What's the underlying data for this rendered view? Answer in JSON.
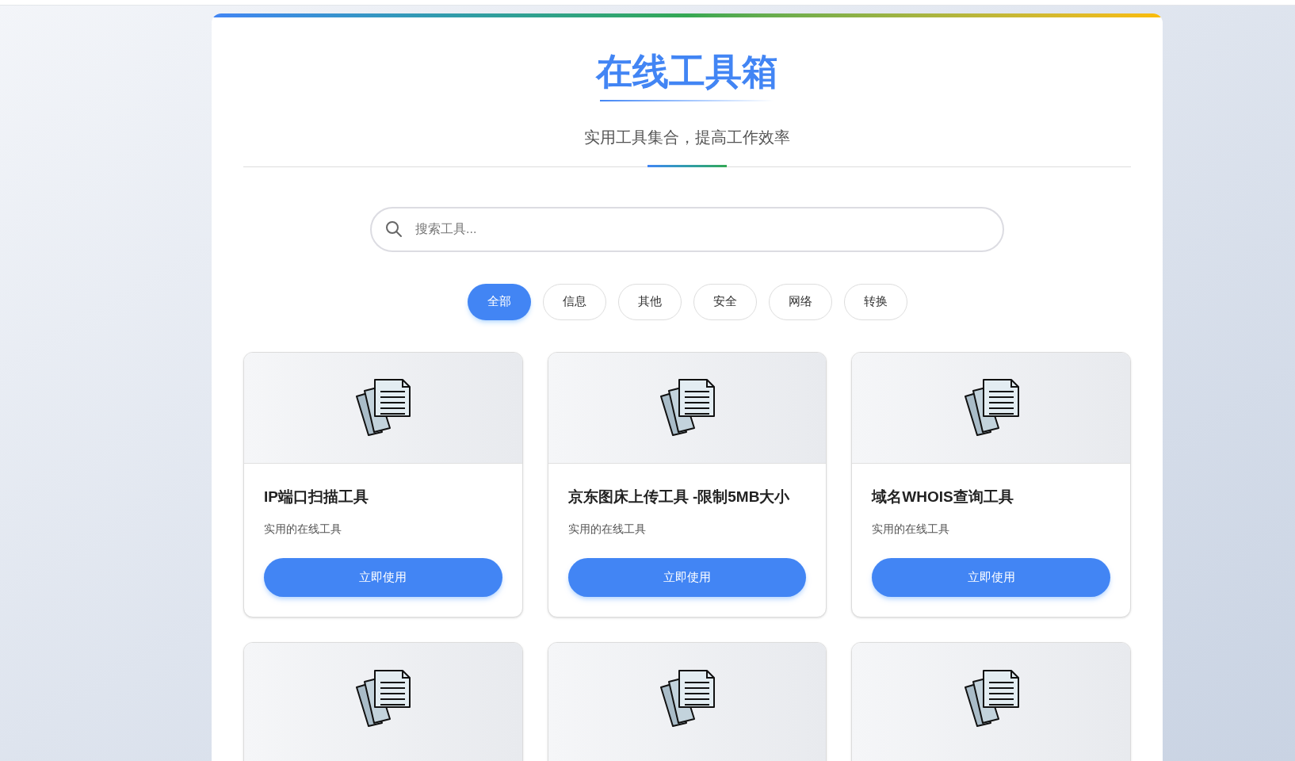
{
  "header": {
    "title": "在线工具箱",
    "subtitle": "实用工具集合，提高工作效率"
  },
  "search": {
    "placeholder": "搜索工具..."
  },
  "filters": [
    {
      "label": "全部",
      "selected": true
    },
    {
      "label": "信息",
      "selected": false
    },
    {
      "label": "其他",
      "selected": false
    },
    {
      "label": "安全",
      "selected": false
    },
    {
      "label": "网络",
      "selected": false
    },
    {
      "label": "转换",
      "selected": false
    }
  ],
  "cards": [
    {
      "kind": "full",
      "title": "IP端口扫描工具",
      "description": "实用的在线工具",
      "button": "立即使用"
    },
    {
      "kind": "full",
      "title": "京东图床上传工具 -限制5MB大小",
      "description": "实用的在线工具",
      "button": "立即使用"
    },
    {
      "kind": "full",
      "title": "域名WHOIS查询工具",
      "description": "实用的在线工具",
      "button": "立即使用"
    },
    {
      "kind": "cut"
    },
    {
      "kind": "cut"
    },
    {
      "kind": "cut"
    }
  ]
}
